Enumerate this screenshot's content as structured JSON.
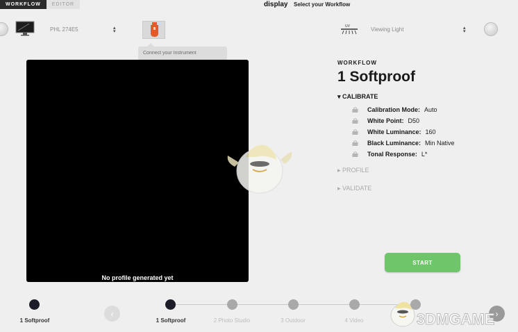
{
  "header": {
    "tabs": [
      {
        "label": "WORKFLOW",
        "active": true
      },
      {
        "label": "EDITOR",
        "active": false
      }
    ],
    "app_title": "display",
    "subtitle": "Select your Workflow"
  },
  "devices": {
    "display_select": "PHL 274E5",
    "instrument_tooltip": "Connect your Instrument",
    "light_select": "Viewing Light"
  },
  "preview": {
    "caption": "No profile generated yet"
  },
  "workflow": {
    "label": "WORKFLOW",
    "title": "1 Softproof",
    "calibrate": {
      "label": "▾ CALIBRATE",
      "settings": [
        {
          "key": "Calibration Mode:",
          "value": "Auto"
        },
        {
          "key": "White Point:",
          "value": "D50"
        },
        {
          "key": "White Luminance:",
          "value": "160"
        },
        {
          "key": "Black Luminance:",
          "value": "Min Native"
        },
        {
          "key": "Tonal Response:",
          "value": "L*"
        }
      ]
    },
    "profile_label": "▸ PROFILE",
    "validate_label": "▸ VALIDATE",
    "start_label": "START"
  },
  "footer": {
    "current": "1 Softproof",
    "steps": [
      {
        "label": "1 Softproof",
        "active": true
      },
      {
        "label": "2 Photo Studio",
        "active": false
      },
      {
        "label": "3 Outdoor",
        "active": false
      },
      {
        "label": "4 Video",
        "active": false
      }
    ]
  },
  "watermark": {
    "text": "3DMGAME"
  },
  "colors": {
    "accent_start": "#6fc66a",
    "active_step": "#1d1d2a",
    "instrument": "#e2592a"
  }
}
